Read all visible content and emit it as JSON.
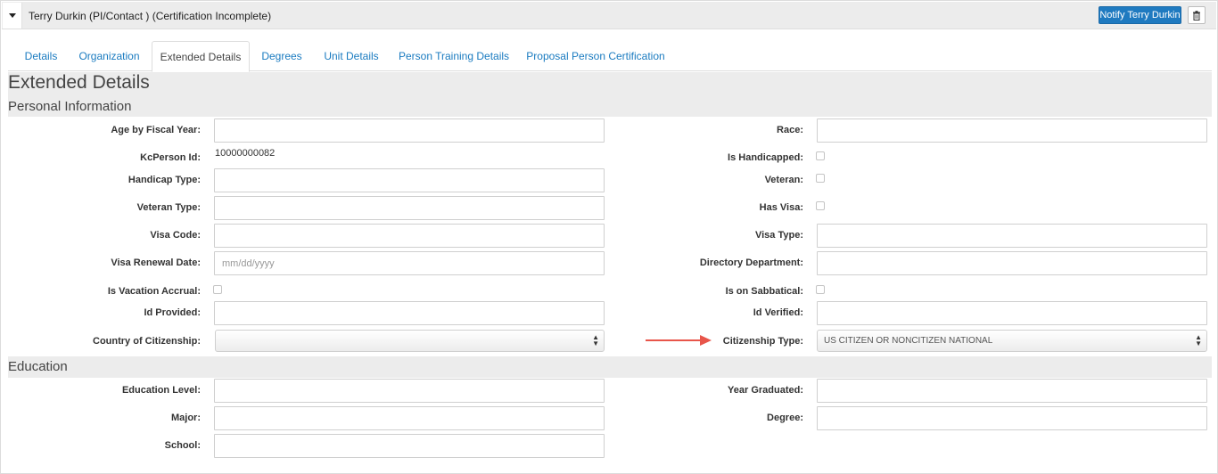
{
  "header": {
    "title": "Terry Durkin (PI/Contact ) (Certification Incomplete)",
    "notify_label": "Notify Terry Durkin"
  },
  "tabs": [
    {
      "label": "Details"
    },
    {
      "label": "Organization"
    },
    {
      "label": "Extended Details",
      "active": true
    },
    {
      "label": "Degrees"
    },
    {
      "label": "Unit Details"
    },
    {
      "label": "Person Training Details"
    },
    {
      "label": "Proposal Person Certification"
    }
  ],
  "page_heading": "Extended Details",
  "personal": {
    "heading": "Personal Information",
    "age_label": "Age by Fiscal Year:",
    "age_value": "",
    "race_label": "Race:",
    "race_value": "",
    "kcperson_label": "KcPerson Id:",
    "kcperson_value": "10000000082",
    "handicapped_label": "Is Handicapped:",
    "handicapped": false,
    "handicap_type_label": "Handicap Type:",
    "handicap_type_value": "",
    "veteran_label": "Veteran:",
    "veteran": false,
    "veteran_type_label": "Veteran Type:",
    "veteran_type_value": "",
    "has_visa_label": "Has Visa:",
    "has_visa": false,
    "visa_code_label": "Visa Code:",
    "visa_code_value": "",
    "visa_type_label": "Visa Type:",
    "visa_type_value": "",
    "visa_renewal_label": "Visa Renewal Date:",
    "visa_renewal_placeholder": "mm/dd/yyyy",
    "directory_dept_label": "Directory Department:",
    "directory_dept_value": "",
    "vacation_label": "Is Vacation Accrual:",
    "vacation": false,
    "sabbatical_label": "Is on Sabbatical:",
    "sabbatical": false,
    "id_provided_label": "Id Provided:",
    "id_provided_value": "",
    "id_verified_label": "Id Verified:",
    "id_verified_value": "",
    "country_label": "Country of Citizenship:",
    "country_value": "",
    "citizenship_type_label": "Citizenship Type:",
    "citizenship_type_value": "US CITIZEN OR NONCITIZEN NATIONAL"
  },
  "education": {
    "heading": "Education",
    "level_label": "Education Level:",
    "level_value": "",
    "year_label": "Year Graduated:",
    "year_value": "",
    "major_label": "Major:",
    "major_value": "",
    "degree_label": "Degree:",
    "degree_value": "",
    "school_label": "School:",
    "school_value": ""
  },
  "annotation": {
    "arrow_color": "#e8554a"
  },
  "colors": {
    "primary": "#1f7ac0",
    "link": "#1a7bc0",
    "section_bg": "#ececec"
  },
  "icons": {
    "collapse": "caret-down-icon",
    "delete": "trash-icon",
    "select": "updown-arrows-icon"
  }
}
